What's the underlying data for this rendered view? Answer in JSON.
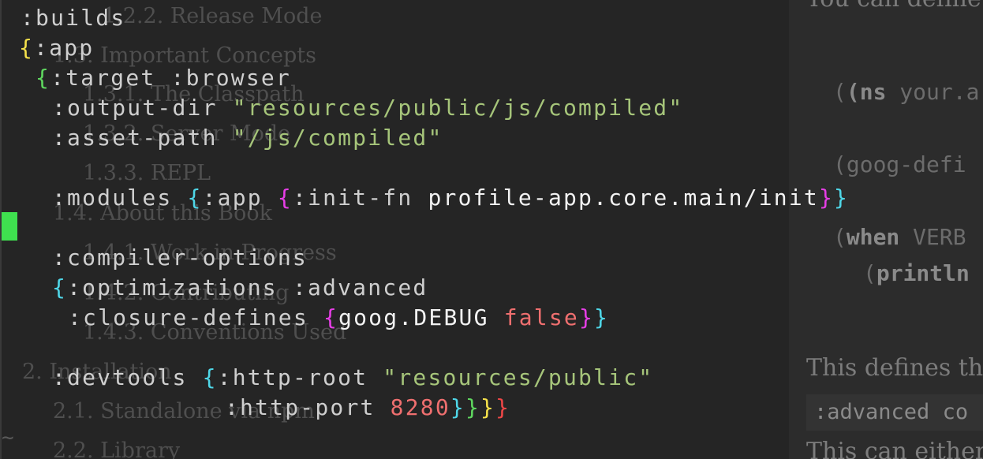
{
  "toc": {
    "items": [
      {
        "id": "t1",
        "text": "1.2.2. Release Mode"
      },
      {
        "id": "t2",
        "text": "1.3. Important Concepts"
      },
      {
        "id": "t3",
        "text": "1.3.1. The Classpath"
      },
      {
        "id": "t4",
        "text": "1.3.2. Server Mode"
      },
      {
        "id": "t5",
        "text": "1.3.3. REPL"
      },
      {
        "id": "t6",
        "text": "1.4. About this Book"
      },
      {
        "id": "t7",
        "text": "1.4.1. Work in Progress"
      },
      {
        "id": "t8",
        "text": "1.4.2. Contributing"
      },
      {
        "id": "t9",
        "text": "1.4.3. Conventions Used"
      },
      {
        "id": "t10",
        "text": "2. Installation"
      },
      {
        "id": "t11",
        "text": "2.1. Standalone via npm"
      },
      {
        "id": "t12",
        "text": "2.2. Library"
      }
    ]
  },
  "right_pane": {
    "header_text": "You can define",
    "ns_kw": "(ns",
    "ns_rest": " your.a",
    "goog_line": "(goog-defi",
    "when_kw": "when",
    "when_rest": " VERB",
    "println_kw": "println",
    "para1": "This defines th",
    "inline_code": ":advanced",
    "inline_code_rest": " co",
    "para2": "This can either"
  },
  "code": {
    "builds": ":builds",
    "app_kw": ":app",
    "target_kw": ":target",
    "browser_kw": ":browser",
    "output_dir_kw": ":output-dir",
    "output_dir_val": "\"resources/public/js/compiled\"",
    "asset_path_kw": ":asset-path",
    "asset_path_val": "\"/js/compiled\"",
    "modules_kw": ":modules",
    "modules_app_kw": ":app",
    "init_fn_kw": ":init-fn",
    "init_fn_val": "profile-app.core.main/init",
    "compiler_options_kw": ":compiler-options",
    "optimizations_kw": ":optimizations",
    "advanced_kw": ":advanced",
    "closure_defines_kw": ":closure-defines",
    "goog_debug": "goog.DEBUG",
    "false_val": "false",
    "devtools_kw": ":devtools",
    "http_root_kw": ":http-root",
    "http_root_val": "\"resources/public\"",
    "http_port_kw": ":http-port",
    "http_port_val": "8280"
  },
  "editor": {
    "tilde": "~"
  },
  "colors": {
    "background": "#252525",
    "string": "#a6c57a",
    "number": "#ef6f6f",
    "cursor": "#3fe04f",
    "paren_yellow": "#f5e14b",
    "paren_green": "#5fd75f",
    "paren_cyan": "#4fd7e8",
    "paren_magenta": "#e73ee7",
    "paren_red": "#ef4747"
  }
}
